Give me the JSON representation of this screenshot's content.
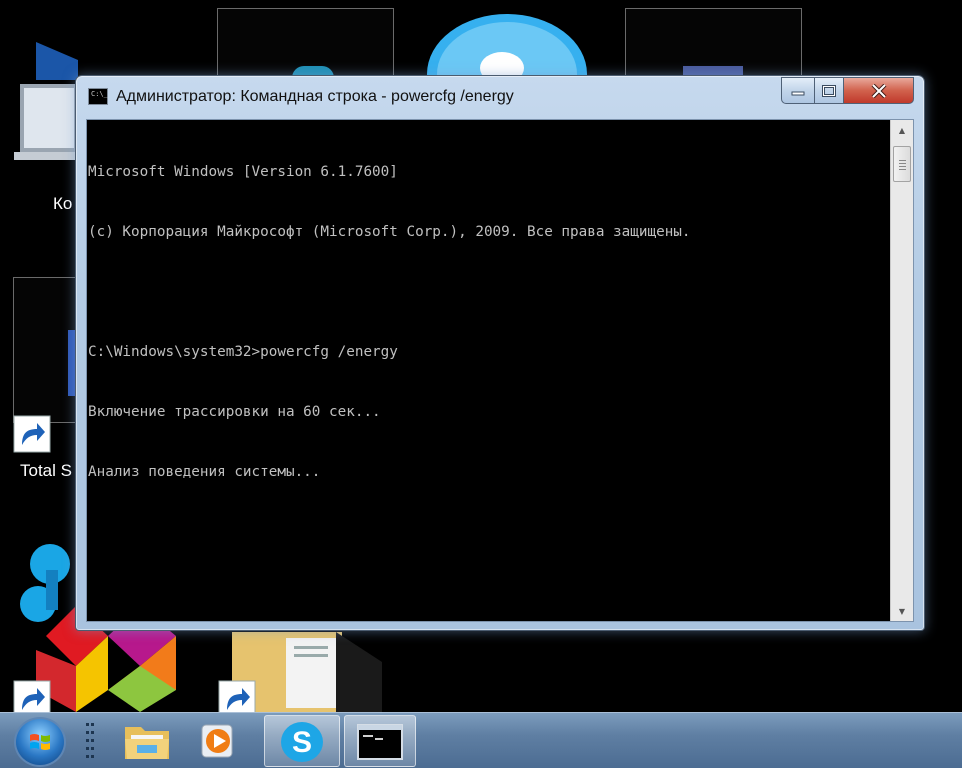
{
  "window": {
    "title": "Администратор: Командная строка - powercfg  /energy",
    "icon_text": "C:\\_",
    "controls": {
      "minimize_icon": "minimize-icon",
      "maximize_icon": "maximize-icon",
      "close_icon": "close-icon"
    }
  },
  "console": {
    "lines": [
      "Microsoft Windows [Version 6.1.7600]",
      "(c) Корпорация Майкрософт (Microsoft Corp.), 2009. Все права защищены.",
      "",
      "C:\\Windows\\system32>powercfg /energy",
      "Включение трассировки на 60 сек...",
      "Анализ поведения системы..."
    ],
    "foreground": "#c0c0c0",
    "background": "#000000"
  },
  "desktop": {
    "icons": [
      {
        "label": "Ко",
        "icon": "computer-icon"
      },
      {
        "label": "Total S",
        "icon": "total-commander-shortcut-icon"
      }
    ]
  },
  "taskbar": {
    "start_icon": "windows-start-orb",
    "items": [
      {
        "name": "explorer",
        "icon": "folder-icon"
      },
      {
        "name": "media-player",
        "icon": "media-player-icon"
      },
      {
        "name": "skype",
        "icon": "skype-icon"
      },
      {
        "name": "cmd",
        "icon": "cmd-icon"
      }
    ],
    "colors": {
      "accent": "#5f7fa3"
    }
  }
}
